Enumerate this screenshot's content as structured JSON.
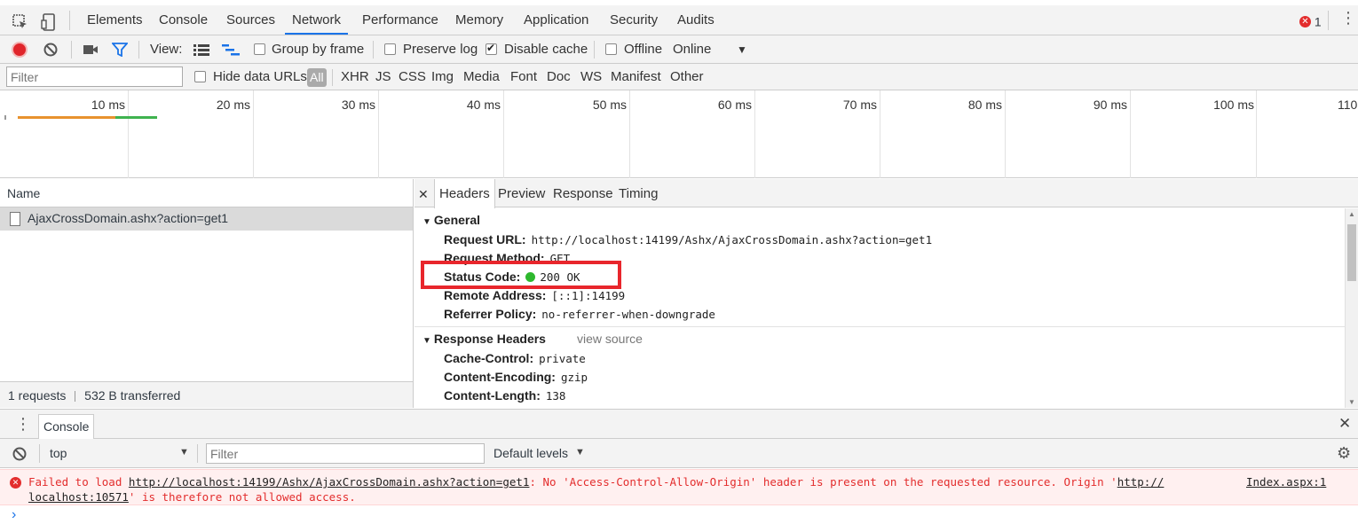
{
  "tabs": {
    "items": [
      "Elements",
      "Console",
      "Sources",
      "Network",
      "Performance",
      "Memory",
      "Application",
      "Security",
      "Audits"
    ],
    "active": "Network",
    "error_count": "1"
  },
  "toolbar": {
    "view_label": "View:",
    "group_by_frame": "Group by frame",
    "preserve_log": "Preserve log",
    "disable_cache": "Disable cache",
    "offline": "Offline",
    "throttle": "Online",
    "disable_cache_checked": true
  },
  "filterbar": {
    "filter_placeholder": "Filter",
    "hide_data_urls": "Hide data URLs",
    "types": [
      "All",
      "XHR",
      "JS",
      "CSS",
      "Img",
      "Media",
      "Font",
      "Doc",
      "WS",
      "Manifest",
      "Other"
    ]
  },
  "timeline": {
    "ticks": [
      "10 ms",
      "20 ms",
      "30 ms",
      "40 ms",
      "50 ms",
      "60 ms",
      "70 ms",
      "80 ms",
      "90 ms",
      "100 ms",
      "110"
    ]
  },
  "requests": {
    "header": "Name",
    "items": [
      {
        "name": "AjaxCrossDomain.ashx?action=get1"
      }
    ],
    "summary_requests": "1 requests",
    "summary_transferred": "532 B transferred"
  },
  "details": {
    "tabs": [
      "Headers",
      "Preview",
      "Response",
      "Timing"
    ],
    "active": "Headers",
    "general_title": "General",
    "general": [
      {
        "k": "Request URL:",
        "v": "http://localhost:14199/Ashx/AjaxCrossDomain.ashx?action=get1"
      },
      {
        "k": "Request Method:",
        "v": "GET"
      },
      {
        "k": "Status Code:",
        "v": "200 OK"
      },
      {
        "k": "Remote Address:",
        "v": "[::1]:14199"
      },
      {
        "k": "Referrer Policy:",
        "v": "no-referrer-when-downgrade"
      }
    ],
    "response_title": "Response Headers",
    "view_source": "view source",
    "response": [
      {
        "k": "Cache-Control:",
        "v": "private"
      },
      {
        "k": "Content-Encoding:",
        "v": "gzip"
      },
      {
        "k": "Content-Length:",
        "v": "138"
      }
    ]
  },
  "console": {
    "tab_label": "Console",
    "context": "top",
    "filter_placeholder": "Filter",
    "levels": "Default levels",
    "error": {
      "prefix": "Failed to load ",
      "url": "http://localhost:14199/Ashx/AjaxCrossDomain.ashx?action=get1",
      "middle": ": No 'Access-Control-Allow-Origin' header is present on the requested resource. Origin '",
      "origin_a": "http://",
      "source": "Index.aspx:1",
      "origin_b": "localhost:10571",
      "suffix": "' is therefore not allowed access."
    },
    "prompt": "›"
  },
  "colors": {
    "accent": "#1a73e8",
    "record": "#e0252b",
    "error": "#e32d2d",
    "highlight": "#e8262c",
    "status_ok": "#2eb82e"
  }
}
